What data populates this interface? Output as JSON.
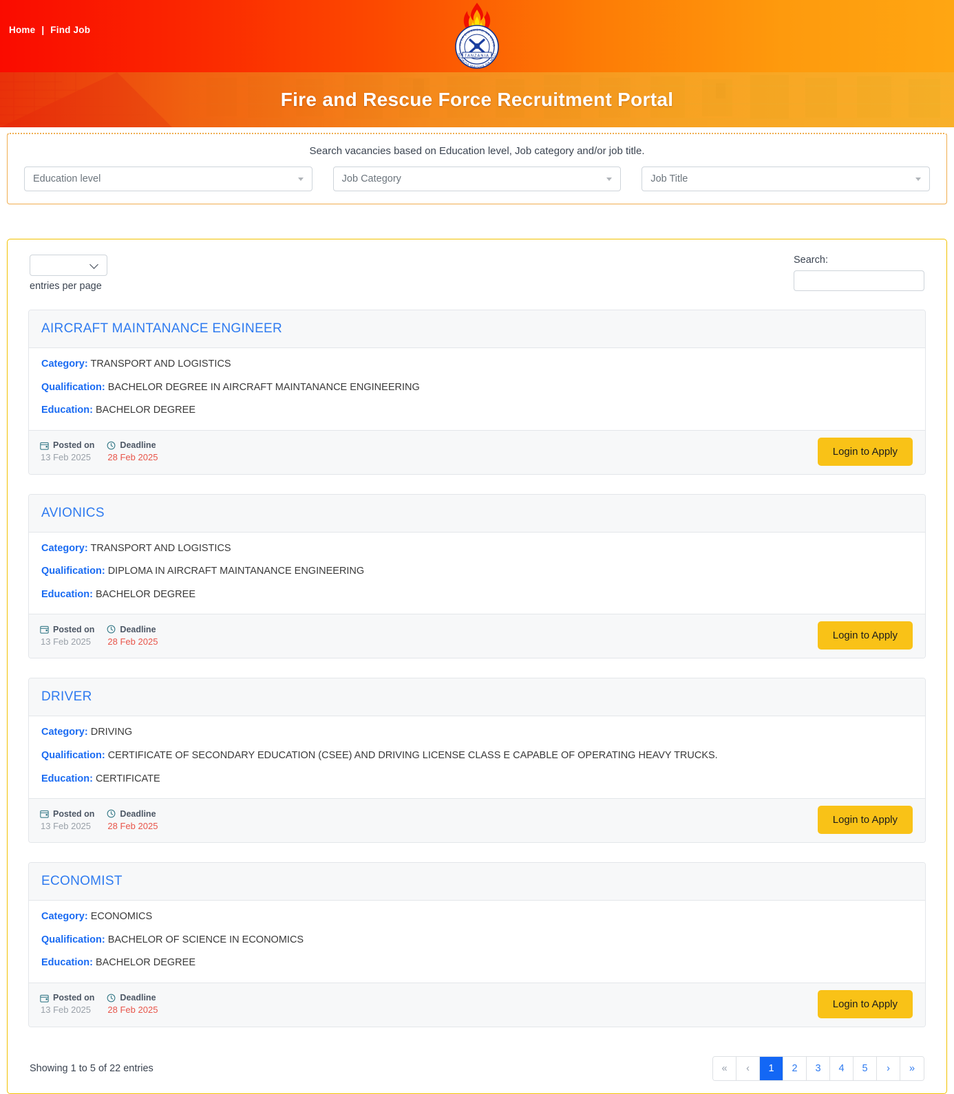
{
  "nav": {
    "home": "Home",
    "separator": "|",
    "find_job": "Find Job"
  },
  "header": {
    "title": "Fire and Rescue Force Recruitment Portal",
    "logo_alt": "Tanzania Fire and Rescue Force emblem",
    "gradient_start": "#fa0b00",
    "gradient_end": "#ffa612"
  },
  "search_panel": {
    "hint": "Search vacancies based on Education level, Job category and/or job title.",
    "education_placeholder": "Education level",
    "category_placeholder": "Job Category",
    "title_placeholder": "Job Title"
  },
  "table_controls": {
    "entries_value": "",
    "entries_label": "entries per page",
    "search_label": "Search:",
    "search_value": "",
    "search_placeholder": ""
  },
  "labels": {
    "category": "Category:",
    "qualification": "Qualification:",
    "education": "Education:",
    "posted_on": "Posted on",
    "deadline": "Deadline",
    "apply": "Login to Apply"
  },
  "jobs": [
    {
      "title": "AIRCRAFT MAINTANANCE ENGINEER",
      "category": "TRANSPORT AND LOGISTICS",
      "qualification": "BACHELOR DEGREE IN AIRCRAFT MAINTANANCE ENGINEERING",
      "education": "BACHELOR DEGREE",
      "posted_on": "13 Feb 2025",
      "deadline": "28 Feb 2025"
    },
    {
      "title": "AVIONICS",
      "category": "TRANSPORT AND LOGISTICS",
      "qualification": "DIPLOMA IN AIRCRAFT MAINTANANCE ENGINEERING",
      "education": "BACHELOR DEGREE",
      "posted_on": "13 Feb 2025",
      "deadline": "28 Feb 2025"
    },
    {
      "title": "DRIVER",
      "category": "DRIVING",
      "qualification": "CERTIFICATE OF SECONDARY EDUCATION (CSEE) AND DRIVING LICENSE CLASS E CAPABLE OF OPERATING HEAVY TRUCKS.",
      "education": "CERTIFICATE",
      "posted_on": "13 Feb 2025",
      "deadline": "28 Feb 2025"
    },
    {
      "title": "ECONOMIST",
      "category": "ECONOMICS",
      "qualification": "BACHELOR OF SCIENCE IN ECONOMICS",
      "education": "BACHELOR DEGREE",
      "posted_on": "13 Feb 2025",
      "deadline": "28 Feb 2025"
    }
  ],
  "footer": {
    "showing": "Showing 1 to 5 of 22 entries",
    "pages": [
      {
        "label": "«",
        "name": "first",
        "state": "muted"
      },
      {
        "label": "‹",
        "name": "previous",
        "state": "muted"
      },
      {
        "label": "1",
        "name": "page-1",
        "state": "active"
      },
      {
        "label": "2",
        "name": "page-2",
        "state": "normal"
      },
      {
        "label": "3",
        "name": "page-3",
        "state": "normal"
      },
      {
        "label": "4",
        "name": "page-4",
        "state": "normal"
      },
      {
        "label": "5",
        "name": "page-5",
        "state": "normal"
      },
      {
        "label": "›",
        "name": "next",
        "state": "normal"
      },
      {
        "label": "»",
        "name": "last",
        "state": "normal"
      }
    ]
  },
  "colors": {
    "accent_yellow": "#f9c217",
    "link_blue": "#2f7bf0",
    "active_page_blue": "#1367f5",
    "deadline_red": "#e8554a",
    "border_gold": "#f2c200"
  }
}
